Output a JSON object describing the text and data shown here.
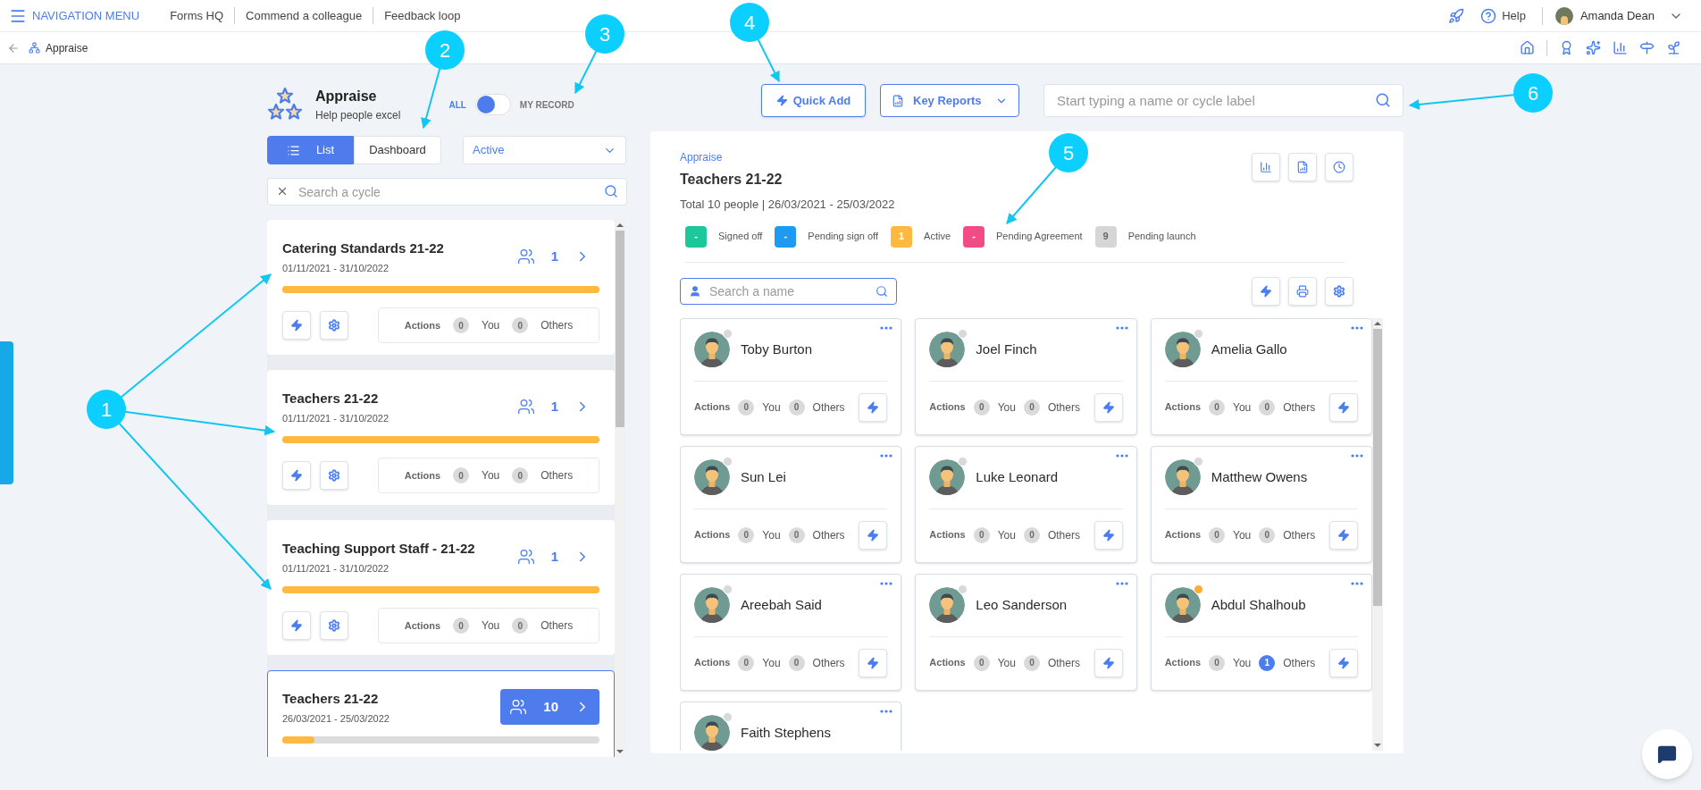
{
  "topbar": {
    "menu_label": "NAVIGATION MENU",
    "links": [
      "Forms HQ",
      "Commend a colleague",
      "Feedback loop"
    ],
    "help": "Help",
    "user": "Amanda Dean"
  },
  "breadcrumb": {
    "label": "Appraise"
  },
  "module": {
    "title": "Appraise",
    "subtitle": "Help people excel"
  },
  "toggle": {
    "left": "ALL",
    "right": "MY RECORD",
    "on": false
  },
  "view_tabs": [
    {
      "label": "List",
      "selected": true
    },
    {
      "label": "Dashboard",
      "selected": false
    }
  ],
  "status_filter": {
    "value": "Active"
  },
  "cycle_search": {
    "placeholder": "Search a cycle"
  },
  "cycles": [
    {
      "title": "Catering Standards 21-22",
      "dates": "01/11/2021 - 31/10/2022",
      "count": "1",
      "level": 1,
      "selected": false,
      "stats": [
        {
          "kind": "label",
          "text": "Actions"
        },
        {
          "kind": "count",
          "text": "0",
          "highlight": false
        },
        {
          "kind": "label",
          "text": "You"
        },
        {
          "kind": "count",
          "text": "0",
          "highlight": false
        },
        {
          "kind": "label",
          "text": "Others"
        }
      ]
    },
    {
      "title": "Teachers 21-22",
      "dates": "01/11/2021 - 31/10/2022",
      "count": "1",
      "level": 1,
      "selected": false,
      "stats": [
        {
          "kind": "label",
          "text": "Actions"
        },
        {
          "kind": "count",
          "text": "0",
          "highlight": false
        },
        {
          "kind": "label",
          "text": "You"
        },
        {
          "kind": "count",
          "text": "0",
          "highlight": false
        },
        {
          "kind": "label",
          "text": "Others"
        }
      ]
    },
    {
      "title": "Teaching Support Staff - 21-22",
      "dates": "01/11/2021 - 31/10/2022",
      "count": "1",
      "level": 1,
      "selected": false,
      "stats": [
        {
          "kind": "label",
          "text": "Actions"
        },
        {
          "kind": "count",
          "text": "0",
          "highlight": false
        },
        {
          "kind": "label",
          "text": "You"
        },
        {
          "kind": "count",
          "text": "0",
          "highlight": false
        },
        {
          "kind": "label",
          "text": "Others"
        }
      ]
    },
    {
      "title": "Teachers 21-22",
      "dates": "26/03/2021 - 25/03/2022",
      "count": "10",
      "level": 0.1,
      "selected": true
    }
  ],
  "toolbar": {
    "quick_add": "Quick Add",
    "key_reports": "Key Reports",
    "search_placeholder": "Start typing a name or cycle label"
  },
  "panel": {
    "crumb": "Appraise",
    "title": "Teachers 21-22",
    "summary": "Total 10 people | 26/03/2021 - 25/03/2022",
    "legend": [
      {
        "count": "-",
        "label": "Signed off",
        "color": "#1cc89a"
      },
      {
        "count": "-",
        "label": "Pending sign off",
        "color": "#1e9bf0"
      },
      {
        "count": "1",
        "label": "Active",
        "color": "#ffb840"
      },
      {
        "count": "-",
        "label": "Pending Agreement",
        "color": "#f24c86"
      },
      {
        "count": "9",
        "label": "Pending launch",
        "color": "#d6d6d6"
      }
    ],
    "name_search_placeholder": "Search a name",
    "people": [
      {
        "name": "Toby Burton",
        "color": "#d9d9d9",
        "stats": [
          {
            "kind": "label",
            "text": "Actions"
          },
          {
            "kind": "count",
            "text": "0",
            "highlight": false
          },
          {
            "kind": "label",
            "text": "You"
          },
          {
            "kind": "count",
            "text": "0",
            "highlight": false
          },
          {
            "kind": "label",
            "text": "Others"
          }
        ]
      },
      {
        "name": "Joel Finch",
        "color": "#d9d9d9",
        "stats": [
          {
            "kind": "label",
            "text": "Actions"
          },
          {
            "kind": "count",
            "text": "0",
            "highlight": false
          },
          {
            "kind": "label",
            "text": "You"
          },
          {
            "kind": "count",
            "text": "0",
            "highlight": false
          },
          {
            "kind": "label",
            "text": "Others"
          }
        ]
      },
      {
        "name": "Amelia Gallo",
        "color": "#d9d9d9",
        "stats": [
          {
            "kind": "label",
            "text": "Actions"
          },
          {
            "kind": "count",
            "text": "0",
            "highlight": false
          },
          {
            "kind": "label",
            "text": "You"
          },
          {
            "kind": "count",
            "text": "0",
            "highlight": false
          },
          {
            "kind": "label",
            "text": "Others"
          }
        ]
      },
      {
        "name": "Sun Lei",
        "color": "#d9d9d9",
        "stats": [
          {
            "kind": "label",
            "text": "Actions"
          },
          {
            "kind": "count",
            "text": "0",
            "highlight": false
          },
          {
            "kind": "label",
            "text": "You"
          },
          {
            "kind": "count",
            "text": "0",
            "highlight": false
          },
          {
            "kind": "label",
            "text": "Others"
          }
        ]
      },
      {
        "name": "Luke Leonard",
        "color": "#d9d9d9",
        "stats": [
          {
            "kind": "label",
            "text": "Actions"
          },
          {
            "kind": "count",
            "text": "0",
            "highlight": false
          },
          {
            "kind": "label",
            "text": "You"
          },
          {
            "kind": "count",
            "text": "0",
            "highlight": false
          },
          {
            "kind": "label",
            "text": "Others"
          }
        ]
      },
      {
        "name": "Matthew Owens",
        "color": "#d9d9d9",
        "stats": [
          {
            "kind": "label",
            "text": "Actions"
          },
          {
            "kind": "count",
            "text": "0",
            "highlight": false
          },
          {
            "kind": "label",
            "text": "You"
          },
          {
            "kind": "count",
            "text": "0",
            "highlight": false
          },
          {
            "kind": "label",
            "text": "Others"
          }
        ]
      },
      {
        "name": "Areebah Said",
        "color": "#d9d9d9",
        "stats": [
          {
            "kind": "label",
            "text": "Actions"
          },
          {
            "kind": "count",
            "text": "0",
            "highlight": false
          },
          {
            "kind": "label",
            "text": "You"
          },
          {
            "kind": "count",
            "text": "0",
            "highlight": false
          },
          {
            "kind": "label",
            "text": "Others"
          }
        ]
      },
      {
        "name": "Leo Sanderson",
        "color": "#d9d9d9",
        "stats": [
          {
            "kind": "label",
            "text": "Actions"
          },
          {
            "kind": "count",
            "text": "0",
            "highlight": false
          },
          {
            "kind": "label",
            "text": "You"
          },
          {
            "kind": "count",
            "text": "0",
            "highlight": false
          },
          {
            "kind": "label",
            "text": "Others"
          }
        ]
      },
      {
        "name": "Abdul Shalhoub",
        "color": "#ffad33",
        "stats": [
          {
            "kind": "label",
            "text": "Actions"
          },
          {
            "kind": "count",
            "text": "0",
            "highlight": false
          },
          {
            "kind": "label",
            "text": "You"
          },
          {
            "kind": "count",
            "text": "1",
            "highlight": true
          },
          {
            "kind": "label",
            "text": "Others"
          }
        ]
      },
      {
        "name": "Faith Stephens",
        "color": "#d9d9d9"
      }
    ]
  },
  "callouts": [
    {
      "text": "1"
    },
    {
      "text": "2"
    },
    {
      "text": "3"
    },
    {
      "text": "4"
    },
    {
      "text": "5"
    },
    {
      "text": "6"
    }
  ]
}
